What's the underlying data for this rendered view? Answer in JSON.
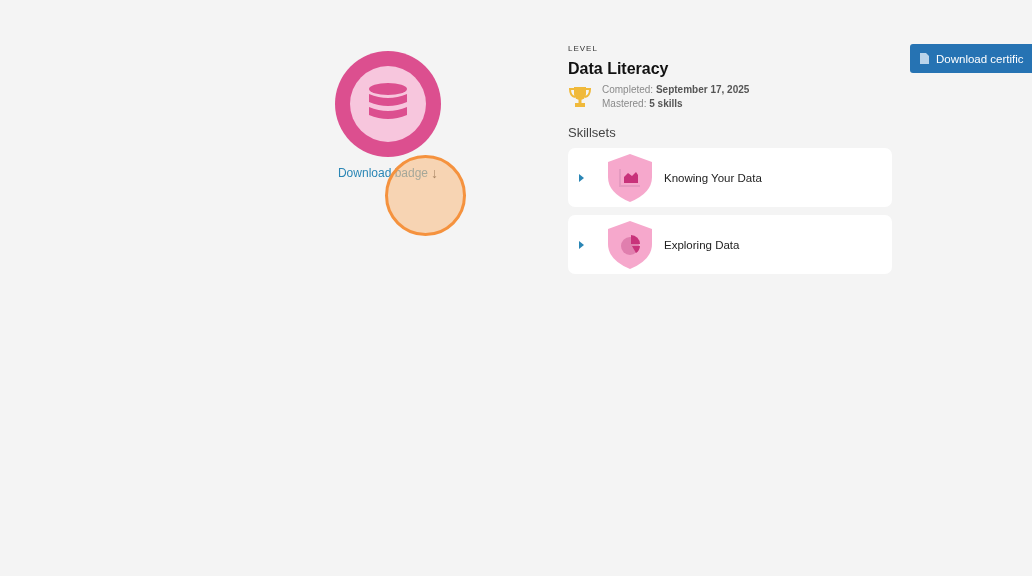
{
  "badge": {
    "download_label": "Download badge",
    "download_arrow": "↓"
  },
  "level": {
    "eyebrow": "LEVEL",
    "title": "Data Literacy",
    "completed_label": "Completed:",
    "completed_value": "September 17, 2025",
    "mastered_label": "Mastered:",
    "mastered_value": "5 skills"
  },
  "skillsets": {
    "heading": "Skillsets",
    "items": [
      {
        "name": "Knowing Your Data",
        "kind": "area-chart",
        "expanded": false
      },
      {
        "name": "Exploring Data",
        "kind": "pie-chart",
        "expanded": false
      }
    ]
  },
  "certificate_button": {
    "label": "Download certific"
  }
}
